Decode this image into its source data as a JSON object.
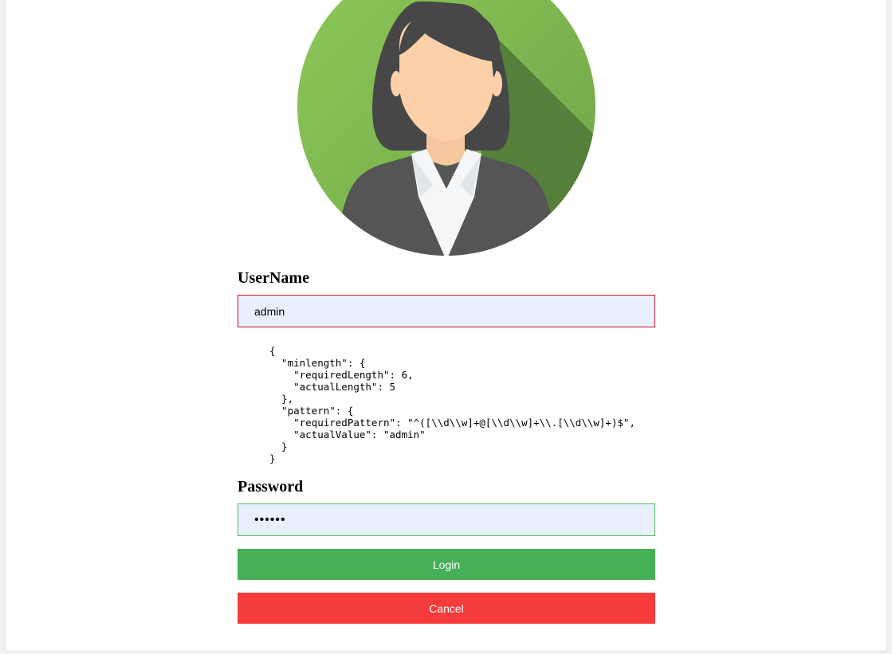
{
  "form": {
    "username": {
      "label": "UserName",
      "value": "admin"
    },
    "validation_errors_text": "{\n  \"minlength\": {\n    \"requiredLength\": 6,\n    \"actualLength\": 5\n  },\n  \"pattern\": {\n    \"requiredPattern\": \"^([\\\\d\\\\w]+@[\\\\d\\\\w]+\\\\.[\\\\d\\\\w]+)$\",\n    \"actualValue\": \"admin\"\n  }\n}",
    "password": {
      "label": "Password",
      "value": "••••••"
    },
    "login_label": "Login",
    "cancel_label": "Cancel"
  },
  "avatar": {
    "icon": "woman-avatar-icon",
    "bg_color": "#8bc34a"
  },
  "colors": {
    "login_button": "#45b058",
    "cancel_button": "#f53b3b",
    "invalid_border": "#c8102e",
    "valid_border": "#5cb85c",
    "input_fill": "#e8f0fe"
  }
}
